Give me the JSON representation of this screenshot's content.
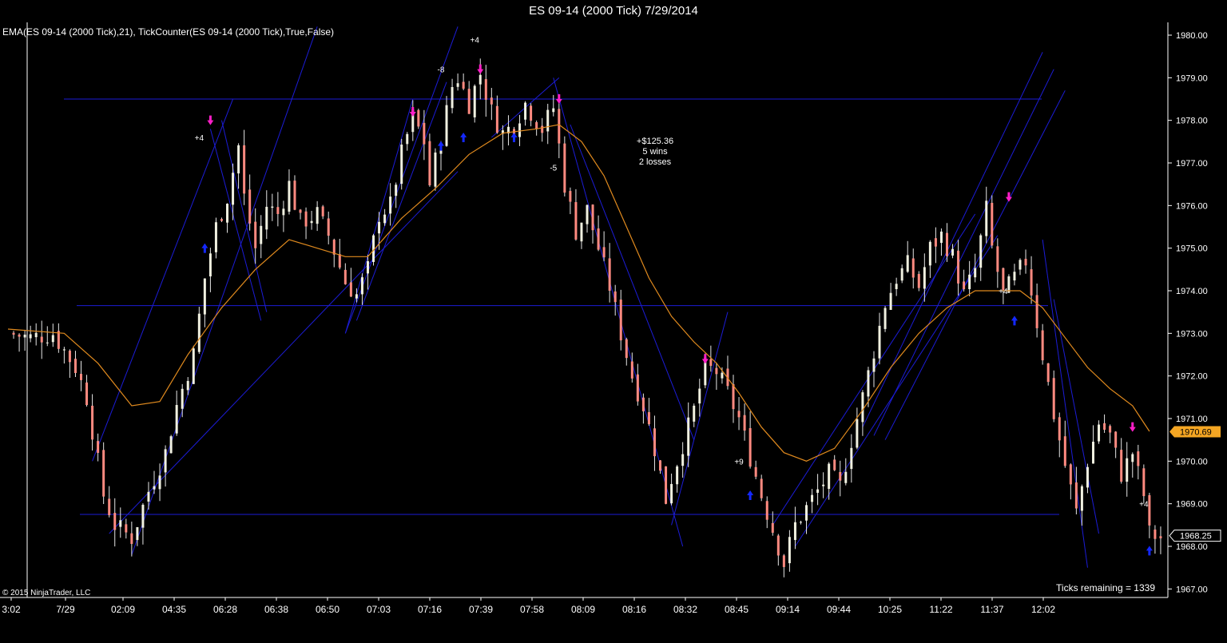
{
  "window_title": "ES 09-14 (2000 Tick)  7/29/2014",
  "indicators_label": "EMA(ES 09-14 (2000 Tick),21),  TickCounter(ES 09-14 (2000 Tick),True,False)",
  "copyright": "© 2015 NinjaTrader, LLC",
  "ticks_remaining": "Ticks remaining = 1339",
  "stats": {
    "pnl": "+$125.36",
    "wins": "5 wins",
    "losses": "2 losses"
  },
  "colors": {
    "background": "#000000",
    "up_candle": "#f0f0e0",
    "down_candle": "#ff8a80",
    "ema": "#e08a1e",
    "trendline": "#1c1cd6",
    "buy_arrow": "#1428ff",
    "sell_arrow": "#ff1ec8",
    "price_marker_bg": "#f5a623",
    "axis": "#ffffff"
  },
  "chart_data": {
    "type": "candlestick",
    "symbol": "ES 09-14",
    "bar_type": "2000 Tick",
    "date": "7/29/2014",
    "ylim": [
      1966.8,
      1980.3
    ],
    "y_ticks": [
      "1967.00",
      "1968.00",
      "1969.00",
      "1970.00",
      "1971.00",
      "1972.00",
      "1973.00",
      "1974.00",
      "1975.00",
      "1976.00",
      "1977.00",
      "1978.00",
      "1979.00",
      "1980.00"
    ],
    "x_ticks": [
      "3:02",
      "7/29",
      "02:09",
      "04:35",
      "06:28",
      "06:38",
      "06:50",
      "07:03",
      "07:16",
      "07:39",
      "07:58",
      "08:09",
      "08:16",
      "08:32",
      "08:45",
      "09:14",
      "09:44",
      "10:25",
      "11:22",
      "11:37",
      "12:02"
    ],
    "last_price": "1970.69",
    "current_price": "1968.25",
    "close_path": [
      [
        0,
        1973.0
      ],
      [
        4,
        1972.9
      ],
      [
        8,
        1973.0
      ],
      [
        12,
        1972.2
      ],
      [
        14,
        1971.5
      ],
      [
        17,
        1969.2
      ],
      [
        19,
        1968.5
      ],
      [
        22,
        1968.2
      ],
      [
        25,
        1969.3
      ],
      [
        28,
        1970.2
      ],
      [
        30,
        1971.3
      ],
      [
        33,
        1972.5
      ],
      [
        35,
        1974.3
      ],
      [
        37,
        1975.5
      ],
      [
        39,
        1976.2
      ],
      [
        41,
        1977.4
      ],
      [
        42,
        1976.2
      ],
      [
        44,
        1975.0
      ],
      [
        46,
        1976.0
      ],
      [
        48,
        1975.8
      ],
      [
        50,
        1976.5
      ],
      [
        52,
        1975.6
      ],
      [
        55,
        1975.8
      ],
      [
        57,
        1975.3
      ],
      [
        60,
        1974.2
      ],
      [
        62,
        1973.9
      ],
      [
        64,
        1974.5
      ],
      [
        66,
        1975.8
      ],
      [
        68,
        1976.0
      ],
      [
        70,
        1977.2
      ],
      [
        72,
        1978.1
      ],
      [
        74,
        1977.5
      ],
      [
        75,
        1976.5
      ],
      [
        77,
        1977.6
      ],
      [
        79,
        1978.8
      ],
      [
        80,
        1979.0
      ],
      [
        82,
        1978.4
      ],
      [
        84,
        1979.1
      ],
      [
        86,
        1978.2
      ],
      [
        88,
        1977.7
      ],
      [
        90,
        1977.9
      ],
      [
        92,
        1978.4
      ],
      [
        95,
        1977.8
      ],
      [
        97,
        1978.3
      ],
      [
        99,
        1976.5
      ],
      [
        101,
        1975.4
      ],
      [
        103,
        1975.9
      ],
      [
        105,
        1975.0
      ],
      [
        107,
        1974.1
      ],
      [
        109,
        1973.0
      ],
      [
        111,
        1972.0
      ],
      [
        113,
        1971.3
      ],
      [
        115,
        1970.3
      ],
      [
        117,
        1969.1
      ],
      [
        118,
        1969.6
      ],
      [
        120,
        1970.4
      ],
      [
        122,
        1971.2
      ],
      [
        124,
        1972.2
      ],
      [
        126,
        1972.1
      ],
      [
        128,
        1971.6
      ],
      [
        130,
        1971.0
      ],
      [
        132,
        1970.1
      ],
      [
        134,
        1969.2
      ],
      [
        136,
        1968.4
      ],
      [
        138,
        1967.6
      ],
      [
        140,
        1968.5
      ],
      [
        142,
        1968.9
      ],
      [
        144,
        1969.3
      ],
      [
        146,
        1969.7
      ],
      [
        148,
        1969.4
      ],
      [
        150,
        1970.5
      ],
      [
        152,
        1971.5
      ],
      [
        154,
        1972.6
      ],
      [
        156,
        1973.7
      ],
      [
        158,
        1974.3
      ],
      [
        160,
        1974.6
      ],
      [
        162,
        1974.1
      ],
      [
        164,
        1975.0
      ],
      [
        166,
        1975.3
      ],
      [
        168,
        1974.8
      ],
      [
        170,
        1973.9
      ],
      [
        172,
        1974.5
      ],
      [
        174,
        1975.9
      ],
      [
        175,
        1975.0
      ],
      [
        177,
        1973.9
      ],
      [
        179,
        1974.3
      ],
      [
        181,
        1974.7
      ],
      [
        182,
        1974.0
      ],
      [
        184,
        1972.5
      ],
      [
        186,
        1971.1
      ],
      [
        188,
        1969.9
      ],
      [
        190,
        1968.8
      ],
      [
        192,
        1970.0
      ],
      [
        194,
        1970.9
      ],
      [
        196,
        1970.6
      ],
      [
        198,
        1969.7
      ],
      [
        200,
        1970.2
      ],
      [
        202,
        1969.2
      ],
      [
        203,
        1968.3
      ],
      [
        205,
        1968.2
      ]
    ],
    "ema": [
      [
        0,
        1973.1
      ],
      [
        10,
        1973.0
      ],
      [
        16,
        1972.3
      ],
      [
        22,
        1971.3
      ],
      [
        27,
        1971.4
      ],
      [
        32,
        1972.5
      ],
      [
        38,
        1973.6
      ],
      [
        44,
        1974.5
      ],
      [
        50,
        1975.2
      ],
      [
        55,
        1975.0
      ],
      [
        60,
        1974.8
      ],
      [
        64,
        1974.8
      ],
      [
        70,
        1975.7
      ],
      [
        76,
        1976.4
      ],
      [
        82,
        1977.2
      ],
      [
        88,
        1977.7
      ],
      [
        94,
        1977.8
      ],
      [
        98,
        1977.9
      ],
      [
        102,
        1977.5
      ],
      [
        106,
        1976.7
      ],
      [
        110,
        1975.5
      ],
      [
        114,
        1974.3
      ],
      [
        118,
        1973.4
      ],
      [
        122,
        1972.8
      ],
      [
        126,
        1972.3
      ],
      [
        130,
        1971.6
      ],
      [
        134,
        1970.8
      ],
      [
        138,
        1970.2
      ],
      [
        142,
        1970.0
      ],
      [
        147,
        1970.3
      ],
      [
        152,
        1971.2
      ],
      [
        157,
        1972.2
      ],
      [
        162,
        1973.0
      ],
      [
        167,
        1973.6
      ],
      [
        172,
        1974.0
      ],
      [
        176,
        1974.0
      ],
      [
        180,
        1974.0
      ],
      [
        184,
        1973.6
      ],
      [
        188,
        1972.9
      ],
      [
        192,
        1972.2
      ],
      [
        196,
        1971.7
      ],
      [
        200,
        1971.3
      ],
      [
        203,
        1970.7
      ]
    ],
    "horizontal_lines": [
      1978.5,
      1973.65,
      1968.75
    ],
    "trades": {
      "buy_arrows": [
        [
          35,
          1975.0
        ],
        [
          77,
          1977.4
        ],
        [
          81,
          1977.6
        ],
        [
          90,
          1977.6
        ],
        [
          132,
          1969.2
        ],
        [
          179,
          1973.3
        ],
        [
          203,
          1967.9
        ]
      ],
      "sell_arrows": [
        [
          36,
          1978.0
        ],
        [
          72,
          1978.2
        ],
        [
          84,
          1979.2
        ],
        [
          98,
          1978.5
        ],
        [
          124,
          1972.4
        ],
        [
          178,
          1976.2
        ],
        [
          200,
          1970.8
        ]
      ],
      "labels": [
        {
          "text": "+4",
          "at": [
            34,
            1977.6
          ]
        },
        {
          "text": "+4",
          "at": [
            83,
            1979.9
          ]
        },
        {
          "text": "-8",
          "at": [
            77,
            1979.2
          ]
        },
        {
          "text": "-5",
          "at": [
            97,
            1976.9
          ]
        },
        {
          "text": "+9",
          "at": [
            130,
            1970.0
          ]
        },
        {
          "text": "+4",
          "at": [
            177,
            1974.0
          ]
        },
        {
          "text": "+4",
          "at": [
            202,
            1969.0
          ]
        }
      ]
    }
  }
}
